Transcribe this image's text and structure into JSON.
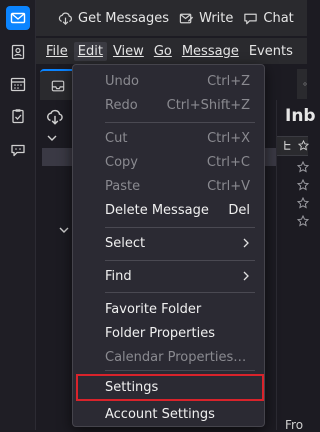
{
  "toolbar": {
    "get_messages": "Get Messages",
    "write": "Write",
    "chat": "Chat"
  },
  "menubar": [
    "File",
    "Edit",
    "View",
    "Go",
    "Message",
    "Events"
  ],
  "thread_pane": {
    "title": "Inb",
    "footer": "Fro"
  },
  "edit_menu": {
    "items": [
      {
        "label": "Undo",
        "shortcut": "Ctrl+Z",
        "disabled": true
      },
      {
        "label": "Redo",
        "shortcut": "Ctrl+Shift+Z",
        "disabled": true
      },
      {
        "label": "Cut",
        "shortcut": "Ctrl+X",
        "disabled": true
      },
      {
        "label": "Copy",
        "shortcut": "Ctrl+C",
        "disabled": true
      },
      {
        "label": "Paste",
        "shortcut": "Ctrl+V",
        "disabled": true
      },
      {
        "label": "Delete Message",
        "shortcut": "Del",
        "disabled": false
      },
      {
        "label": "Select",
        "submenu": true,
        "disabled": false
      },
      {
        "label": "Find",
        "submenu": true,
        "disabled": false
      },
      {
        "label": "Favorite Folder",
        "disabled": false
      },
      {
        "label": "Folder Properties",
        "disabled": false
      },
      {
        "label": "Calendar Properties…",
        "disabled": true
      },
      {
        "label": "Settings",
        "disabled": false,
        "highlighted": true
      },
      {
        "label": "Account Settings",
        "disabled": false
      }
    ]
  },
  "colors": {
    "accent": "#0b84ff",
    "highlight_box": "#d9232b",
    "menu_bg": "#2b2a33"
  },
  "icons": {
    "spaces": [
      "mail-icon",
      "address-book-icon",
      "calendar-icon",
      "tasks-icon",
      "chat-icon"
    ],
    "toolbar": [
      "get-messages-icon",
      "write-icon",
      "chat-icon"
    ]
  }
}
